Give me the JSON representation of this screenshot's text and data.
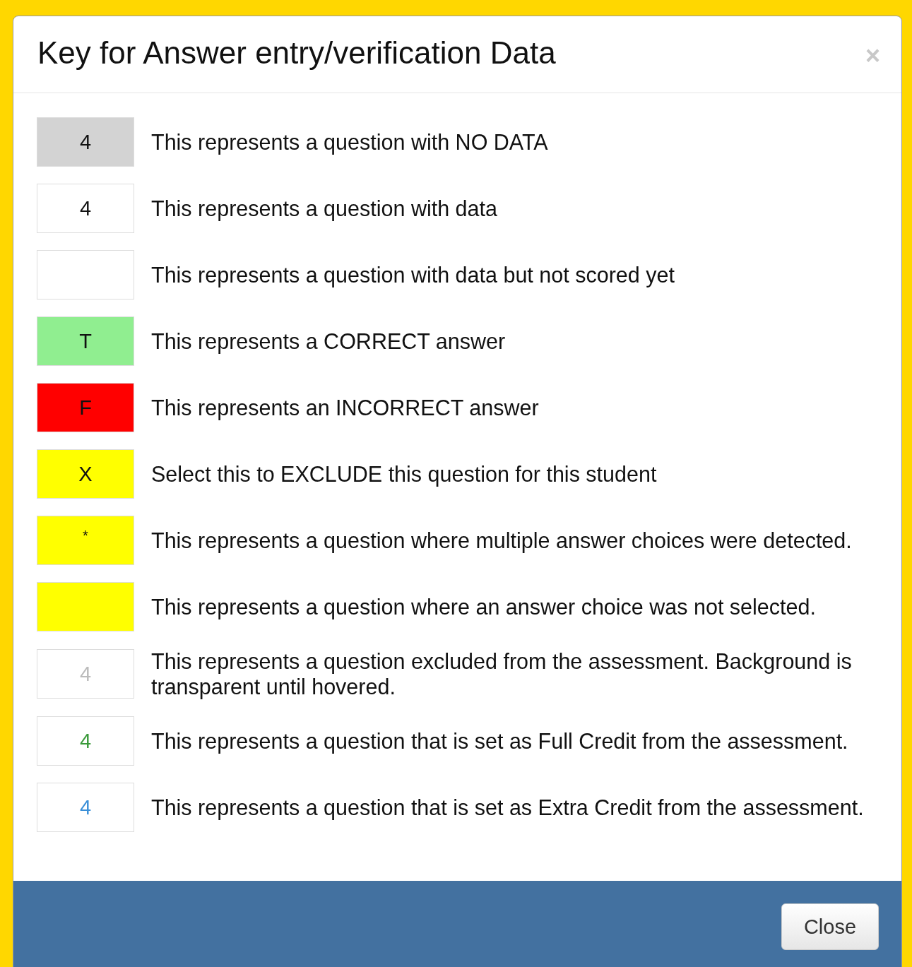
{
  "dialog": {
    "title": "Key for Answer entry/verification Data",
    "close_icon": "×"
  },
  "items": [
    {
      "label": "4",
      "color": "#d3d3d3",
      "kind": "normal",
      "description": "This represents a question with NO DATA"
    },
    {
      "label": "4",
      "color": "#ffffff",
      "kind": "normal",
      "description": "This represents a question with data"
    },
    {
      "color": "#ffffff",
      "description": "This represents a question with data but not scored yet"
    },
    {
      "label": "T",
      "color": "#90ee90",
      "kind": "normal",
      "description": "This represents a CORRECT answer"
    },
    {
      "label": "F",
      "color": "#ff0000",
      "kind": "normal",
      "description": "This represents an INCORRECT answer"
    },
    {
      "label": "X",
      "color": "#ffff00",
      "kind": "normal",
      "description": "Select this to EXCLUDE this question for this student"
    },
    {
      "label": "*",
      "color": "#ffff00",
      "kind": "small",
      "description": "This represents a question where multiple answer choices were detected."
    },
    {
      "color": "#ffff00",
      "description": "This represents a question where an answer choice was not selected."
    },
    {
      "label": "4",
      "color": "#ffffff",
      "kind": "excluded",
      "description": "This represents a question excluded from the assessment. Background is transparent until hovered."
    },
    {
      "label": "4",
      "color": "#ffffff",
      "kind": "full_credit",
      "description": "This represents a question that is set as Full Credit from the assessment."
    },
    {
      "label": "4",
      "color": "#ffffff",
      "kind": "extra_credit",
      "description": "This represents a question that is set as Extra Credit from the assessment."
    }
  ],
  "footer": {
    "button": "Close"
  }
}
